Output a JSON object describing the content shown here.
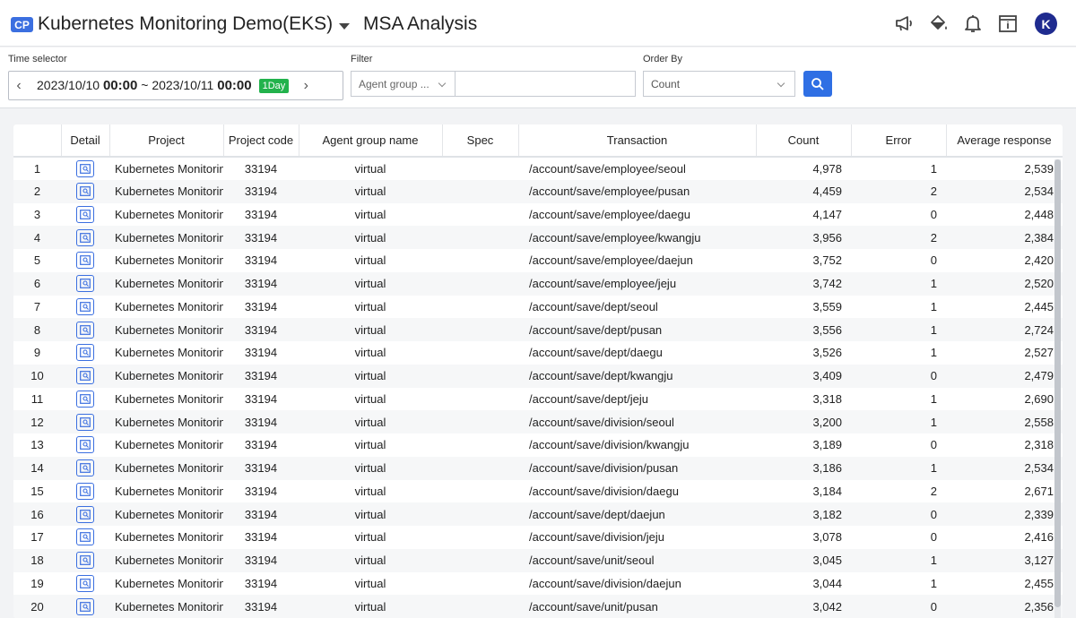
{
  "header": {
    "badge": "CP",
    "project_title": "Kubernetes Monitoring Demo(EKS)",
    "page_title": "MSA Analysis",
    "avatar_letter": "K",
    "icons": [
      "megaphone-icon",
      "paint-bucket-icon",
      "bell-icon",
      "calendar-icon"
    ]
  },
  "toolbar": {
    "time_label": "Time selector",
    "time_start_date": "2023/10/10",
    "time_start_hm": "00:00",
    "time_sep": "~",
    "time_end_date": "2023/10/11",
    "time_end_hm": "00:00",
    "range_badge": "1Day",
    "filter_label": "Filter",
    "filter_select_value": "Agent group ...",
    "filter_input_value": "",
    "order_label": "Order By",
    "order_value": "Count"
  },
  "table": {
    "columns": [
      "",
      "Detail",
      "Project",
      "Project code",
      "Agent group name",
      "Spec",
      "Transaction",
      "Count",
      "Error",
      "Average response"
    ],
    "rows": [
      {
        "no": "1",
        "project": "Kubernetes Monitoring Demo",
        "code": "33194",
        "agent": "virtual",
        "spec": "",
        "transaction": "/account/save/employee/seoul",
        "count": "4,978",
        "error": "1",
        "avg": "2,539"
      },
      {
        "no": "2",
        "project": "Kubernetes Monitoring Demo",
        "code": "33194",
        "agent": "virtual",
        "spec": "",
        "transaction": "/account/save/employee/pusan",
        "count": "4,459",
        "error": "2",
        "avg": "2,534"
      },
      {
        "no": "3",
        "project": "Kubernetes Monitoring Demo",
        "code": "33194",
        "agent": "virtual",
        "spec": "",
        "transaction": "/account/save/employee/daegu",
        "count": "4,147",
        "error": "0",
        "avg": "2,448"
      },
      {
        "no": "4",
        "project": "Kubernetes Monitoring Demo",
        "code": "33194",
        "agent": "virtual",
        "spec": "",
        "transaction": "/account/save/employee/kwangju",
        "count": "3,956",
        "error": "2",
        "avg": "2,384"
      },
      {
        "no": "5",
        "project": "Kubernetes Monitoring Demo",
        "code": "33194",
        "agent": "virtual",
        "spec": "",
        "transaction": "/account/save/employee/daejun",
        "count": "3,752",
        "error": "0",
        "avg": "2,420"
      },
      {
        "no": "6",
        "project": "Kubernetes Monitoring Demo",
        "code": "33194",
        "agent": "virtual",
        "spec": "",
        "transaction": "/account/save/employee/jeju",
        "count": "3,742",
        "error": "1",
        "avg": "2,520"
      },
      {
        "no": "7",
        "project": "Kubernetes Monitoring Demo",
        "code": "33194",
        "agent": "virtual",
        "spec": "",
        "transaction": "/account/save/dept/seoul",
        "count": "3,559",
        "error": "1",
        "avg": "2,445"
      },
      {
        "no": "8",
        "project": "Kubernetes Monitoring Demo",
        "code": "33194",
        "agent": "virtual",
        "spec": "",
        "transaction": "/account/save/dept/pusan",
        "count": "3,556",
        "error": "1",
        "avg": "2,724"
      },
      {
        "no": "9",
        "project": "Kubernetes Monitoring Demo",
        "code": "33194",
        "agent": "virtual",
        "spec": "",
        "transaction": "/account/save/dept/daegu",
        "count": "3,526",
        "error": "1",
        "avg": "2,527"
      },
      {
        "no": "10",
        "project": "Kubernetes Monitoring Demo",
        "code": "33194",
        "agent": "virtual",
        "spec": "",
        "transaction": "/account/save/dept/kwangju",
        "count": "3,409",
        "error": "0",
        "avg": "2,479"
      },
      {
        "no": "11",
        "project": "Kubernetes Monitoring Demo",
        "code": "33194",
        "agent": "virtual",
        "spec": "",
        "transaction": "/account/save/dept/jeju",
        "count": "3,318",
        "error": "1",
        "avg": "2,690"
      },
      {
        "no": "12",
        "project": "Kubernetes Monitoring Demo",
        "code": "33194",
        "agent": "virtual",
        "spec": "",
        "transaction": "/account/save/division/seoul",
        "count": "3,200",
        "error": "1",
        "avg": "2,558"
      },
      {
        "no": "13",
        "project": "Kubernetes Monitoring Demo",
        "code": "33194",
        "agent": "virtual",
        "spec": "",
        "transaction": "/account/save/division/kwangju",
        "count": "3,189",
        "error": "0",
        "avg": "2,318"
      },
      {
        "no": "14",
        "project": "Kubernetes Monitoring Demo",
        "code": "33194",
        "agent": "virtual",
        "spec": "",
        "transaction": "/account/save/division/pusan",
        "count": "3,186",
        "error": "1",
        "avg": "2,534"
      },
      {
        "no": "15",
        "project": "Kubernetes Monitoring Demo",
        "code": "33194",
        "agent": "virtual",
        "spec": "",
        "transaction": "/account/save/division/daegu",
        "count": "3,184",
        "error": "2",
        "avg": "2,671"
      },
      {
        "no": "16",
        "project": "Kubernetes Monitoring Demo",
        "code": "33194",
        "agent": "virtual",
        "spec": "",
        "transaction": "/account/save/dept/daejun",
        "count": "3,182",
        "error": "0",
        "avg": "2,339"
      },
      {
        "no": "17",
        "project": "Kubernetes Monitoring Demo",
        "code": "33194",
        "agent": "virtual",
        "spec": "",
        "transaction": "/account/save/division/jeju",
        "count": "3,078",
        "error": "0",
        "avg": "2,416"
      },
      {
        "no": "18",
        "project": "Kubernetes Monitoring Demo",
        "code": "33194",
        "agent": "virtual",
        "spec": "",
        "transaction": "/account/save/unit/seoul",
        "count": "3,045",
        "error": "1",
        "avg": "3,127"
      },
      {
        "no": "19",
        "project": "Kubernetes Monitoring Demo",
        "code": "33194",
        "agent": "virtual",
        "spec": "",
        "transaction": "/account/save/division/daejun",
        "count": "3,044",
        "error": "1",
        "avg": "2,455"
      },
      {
        "no": "20",
        "project": "Kubernetes Monitoring Demo",
        "code": "33194",
        "agent": "virtual",
        "spec": "",
        "transaction": "/account/save/unit/pusan",
        "count": "3,042",
        "error": "0",
        "avg": "2,356"
      }
    ]
  },
  "colors": {
    "accent": "#2f6fe4",
    "badge_green": "#22b24c",
    "avatar": "#1f2b8f"
  }
}
